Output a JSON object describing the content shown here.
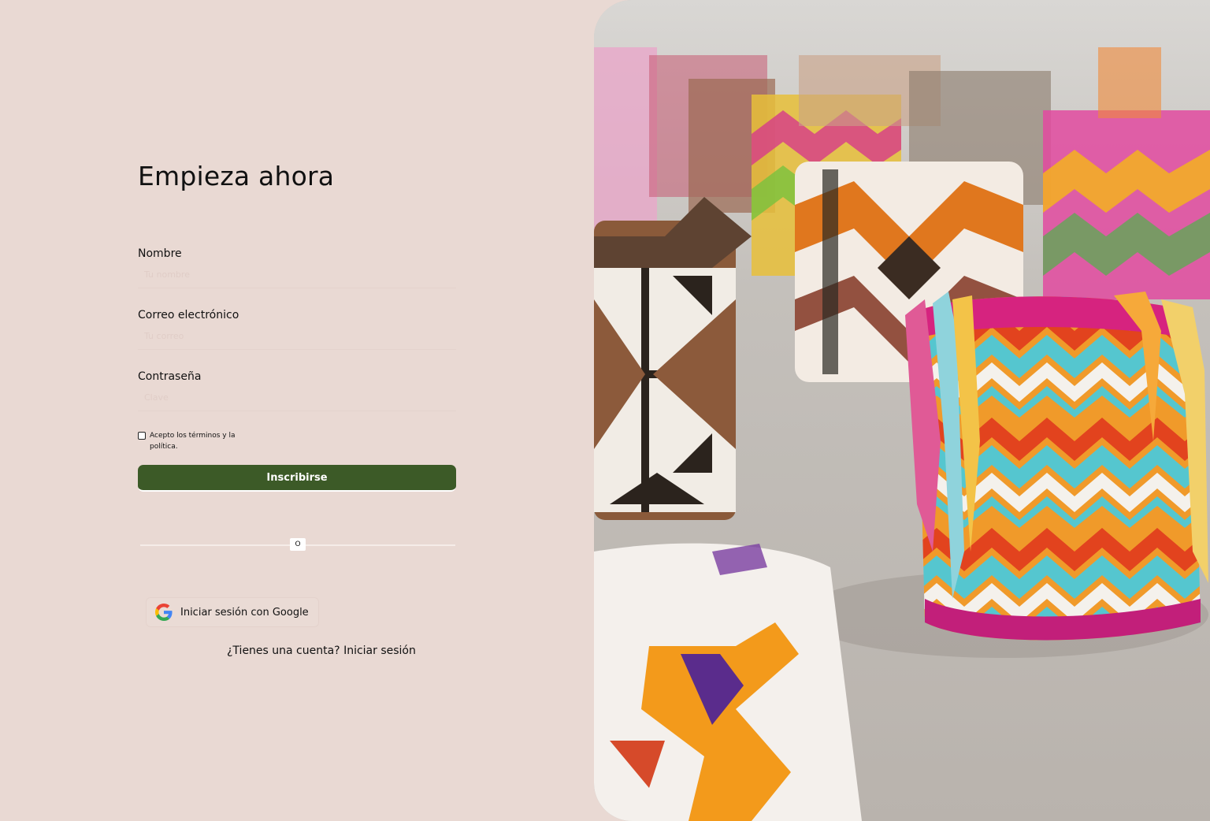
{
  "form": {
    "title": "Empieza ahora",
    "name_label": "Nombre",
    "name_placeholder": "Tu nombre",
    "email_label": "Correo electrónico",
    "email_placeholder": "Tu correo",
    "password_label": "Contraseña",
    "password_placeholder": "Clave",
    "terms_text": "Acepto los términos y la política.",
    "submit_label": "Inscribirse",
    "divider_text": "O",
    "google_label": "Iniciar sesión con Google",
    "login_prompt": "¿Tienes una cuenta? Iniciar sesión"
  },
  "colors": {
    "background": "#e9d9d3",
    "submit_button": "#3c5a27",
    "text": "#111111"
  },
  "icons": {
    "google": "google-logo-icon"
  },
  "hero": {
    "image_subject": "mochilas-wayuu-en-la-arena"
  }
}
